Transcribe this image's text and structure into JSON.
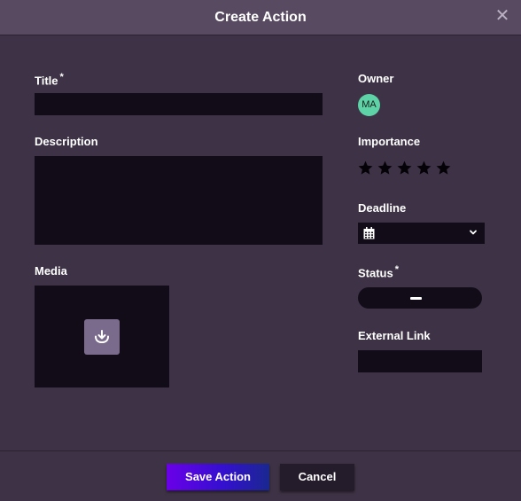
{
  "dialog": {
    "title": "Create Action",
    "close_label": "✕"
  },
  "form": {
    "title_label": "Title",
    "title_required": "*",
    "title_value": "",
    "description_label": "Description",
    "description_value": "",
    "media_label": "Media",
    "owner_label": "Owner",
    "owner_initials": "MA",
    "owner_avatar_color": "#5ed3a8",
    "importance_label": "Importance",
    "importance_rating": 0,
    "importance_max": 5,
    "deadline_label": "Deadline",
    "deadline_value": "",
    "status_label": "Status",
    "status_required": "*",
    "status_value": "",
    "external_link_label": "External Link",
    "external_link_value": ""
  },
  "footer": {
    "save_label": "Save Action",
    "cancel_label": "Cancel"
  },
  "colors": {
    "background": "#3e3346",
    "header": "#574a61",
    "input": "#110c17",
    "save_gradient_start": "#6a00e8",
    "save_gradient_end": "#1a2790"
  }
}
